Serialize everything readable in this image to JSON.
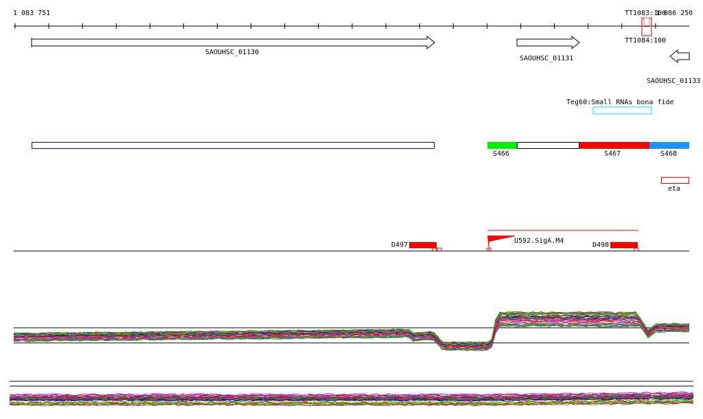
{
  "ruler": {
    "start": "1 083 751",
    "end": "1 086 250"
  },
  "terminators": [
    {
      "label": "TT1083:100"
    },
    {
      "label": "TT1084:100"
    }
  ],
  "genes": [
    {
      "label": "SAOUHSC_01130",
      "strand": "+"
    },
    {
      "label": "SAOUHSC_01131",
      "strand": "+"
    },
    {
      "label": "SAOUHSC_01133",
      "strand": "-"
    }
  ],
  "srna": {
    "label": "Teg60:Small RNAs bona fide"
  },
  "segments": [
    {
      "label": "S466"
    },
    {
      "label": "S467"
    },
    {
      "label": "S468"
    }
  ],
  "eta": {
    "label": "eta"
  },
  "promoters": [
    {
      "label": "D497"
    },
    {
      "label": "U592.SigA.M4"
    },
    {
      "label": "D498"
    }
  ],
  "colors": {
    "red": "#ff0000",
    "green": "#00ee00",
    "blue": "#1e90ff",
    "cyan": "#00e5ee",
    "darkblue": "#0000cc"
  }
}
